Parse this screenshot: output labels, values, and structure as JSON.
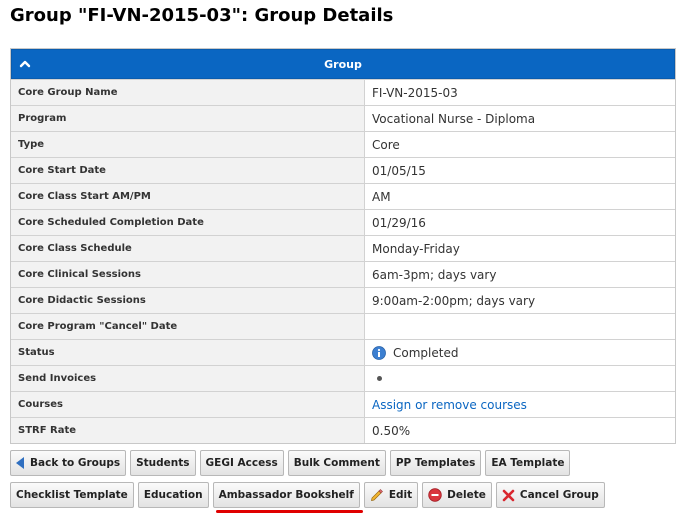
{
  "page": {
    "title": "Group \"FI-VN-2015-03\": Group Details"
  },
  "panel": {
    "header": "Group"
  },
  "fields": [
    {
      "label": "Core Group Name",
      "value": "FI-VN-2015-03"
    },
    {
      "label": "Program",
      "value": "Vocational Nurse - Diploma"
    },
    {
      "label": "Type",
      "value": "Core"
    },
    {
      "label": "Core Start Date",
      "value": "01/05/15"
    },
    {
      "label": "Core Class Start AM/PM",
      "value": "AM"
    },
    {
      "label": "Core Scheduled Completion Date",
      "value": "01/29/16"
    },
    {
      "label": "Core Class Schedule",
      "value": "Monday-Friday"
    },
    {
      "label": "Core Clinical Sessions",
      "value": "6am-3pm; days vary"
    },
    {
      "label": "Core Didactic Sessions",
      "value": "9:00am-2:00pm; days vary"
    },
    {
      "label": "Core Program \"Cancel\" Date",
      "value": ""
    },
    {
      "label": "Status",
      "value": "Completed"
    },
    {
      "label": "Send Invoices",
      "value": ""
    },
    {
      "label": "Courses",
      "value": "Assign or remove courses"
    },
    {
      "label": "STRF Rate",
      "value": "0.50%"
    }
  ],
  "buttons": {
    "back": "Back to Groups",
    "students": "Students",
    "gegi": "GEGI Access",
    "bulk_comment": "Bulk Comment",
    "pp_templates": "PP Templates",
    "ea_template": "EA Template",
    "checklist": "Checklist Template",
    "education": "Education",
    "ambassador": "Ambassador Bookshelf",
    "edit": "Edit",
    "delete": "Delete",
    "cancel_group": "Cancel Group"
  },
  "colors": {
    "header_blue": "#0a66c2",
    "highlight_red": "#e00000"
  }
}
